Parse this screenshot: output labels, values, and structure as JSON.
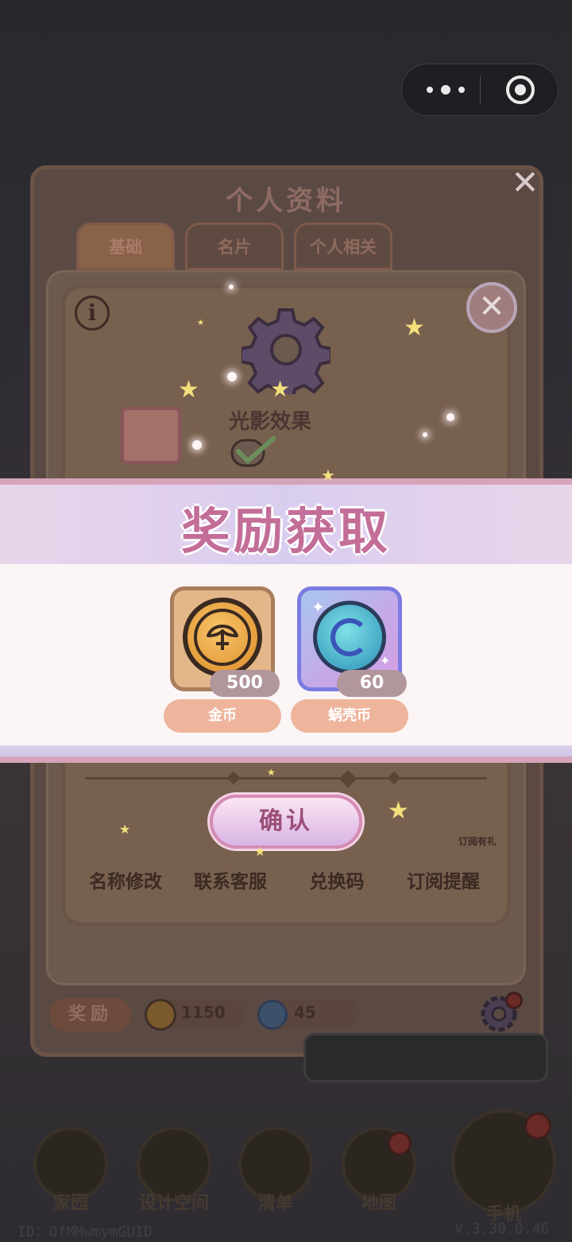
{
  "miniapp": {
    "more_icon": "more-dots-icon",
    "close_icon": "target-close-icon"
  },
  "profile": {
    "title": "个人资料",
    "tabs": [
      {
        "label": "基础",
        "active": true
      },
      {
        "label": "名片",
        "active": false
      },
      {
        "label": "个人相关",
        "active": false
      }
    ],
    "setting_label": "光影效果",
    "actions": [
      {
        "label": "名称修改",
        "icon": "pencil-icon"
      },
      {
        "label": "联系客服",
        "icon": "support-icon"
      },
      {
        "label": "兑换码",
        "icon": "ticket-icon"
      },
      {
        "label": "订阅提醒",
        "icon": "bell-icon"
      }
    ],
    "subscribe_tag": "订阅有礼",
    "reward_label": "奖励",
    "coins": "1150",
    "shells": "45"
  },
  "bottom_nav": [
    {
      "label": "家园",
      "icon": "home-icon"
    },
    {
      "label": "设计空间",
      "icon": "design-icon"
    },
    {
      "label": "清单",
      "icon": "list-icon"
    },
    {
      "label": "地图",
      "icon": "map-pin-icon"
    },
    {
      "label": "手机",
      "icon": "phone-icon"
    }
  ],
  "footer": {
    "id": "ID：OfMMwmymGUID",
    "version": "V.3.30.0.46"
  },
  "reward_popup": {
    "title": "奖励获取",
    "items": [
      {
        "name": "金币",
        "quantity": "500",
        "icon": "coin-icon"
      },
      {
        "name": "蜗壳币",
        "quantity": "60",
        "icon": "shell-coin-icon"
      }
    ],
    "confirm_label": "确认"
  },
  "colors": {
    "accent_pink": "#c36e98",
    "name_pill": "#eeb59c",
    "qty_pill": "#b1969b"
  }
}
